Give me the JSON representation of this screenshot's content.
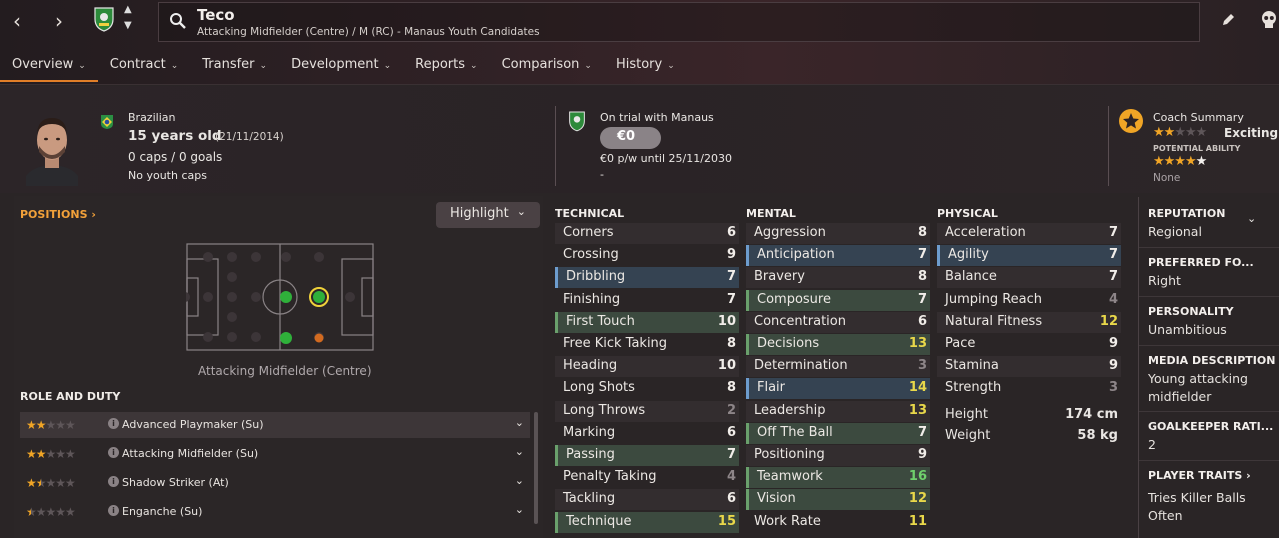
{
  "header": {
    "player_name": "Teco",
    "subtitle": "Attacking Midfielder (Centre) / M (RC) - Manaus Youth Candidates"
  },
  "tabs": [
    {
      "label": "Overview",
      "active": true
    },
    {
      "label": "Contract"
    },
    {
      "label": "Transfer"
    },
    {
      "label": "Development"
    },
    {
      "label": "Reports"
    },
    {
      "label": "Comparison"
    },
    {
      "label": "History"
    }
  ],
  "profile": {
    "nationality": "Brazilian",
    "age": "15 years old",
    "dob": "(21/11/2014)",
    "caps": "0 caps / 0 goals",
    "youth_caps": "No youth caps"
  },
  "club": {
    "status": "On trial with Manaus",
    "value": "€0",
    "wage": "€0 p/w until 25/11/2030",
    "extra": "-"
  },
  "coach": {
    "title": "Coach Summary",
    "current_stars": 2,
    "descriptor": "Exciting y",
    "potential_label": "POTENTIAL ABILITY",
    "potential_stars": 4,
    "footnote": "None"
  },
  "positions": {
    "header": "POSITIONS",
    "highlight_label": "Highlight",
    "main_position": "Attacking Midfielder (Centre)"
  },
  "roles": {
    "header": "ROLE AND DUTY",
    "items": [
      {
        "label": "Advanced Playmaker (Su)",
        "stars": 2
      },
      {
        "label": "Attacking Midfielder (Su)",
        "stars": 2
      },
      {
        "label": "Shadow Striker (At)",
        "stars": 1.5
      },
      {
        "label": "Enganche (Su)",
        "stars": 1
      }
    ]
  },
  "technical": {
    "header": "TECHNICAL",
    "items": [
      {
        "name": "Corners",
        "value": "6"
      },
      {
        "name": "Crossing",
        "value": "9"
      },
      {
        "name": "Dribbling",
        "value": "7",
        "hl": "b"
      },
      {
        "name": "Finishing",
        "value": "7"
      },
      {
        "name": "First Touch",
        "value": "10",
        "hl": "g"
      },
      {
        "name": "Free Kick Taking",
        "value": "8"
      },
      {
        "name": "Heading",
        "value": "10"
      },
      {
        "name": "Long Shots",
        "value": "8"
      },
      {
        "name": "Long Throws",
        "value": "2",
        "tone": "grey"
      },
      {
        "name": "Marking",
        "value": "6"
      },
      {
        "name": "Passing",
        "value": "7",
        "hl": "g"
      },
      {
        "name": "Penalty Taking",
        "value": "4",
        "tone": "grey"
      },
      {
        "name": "Tackling",
        "value": "6"
      },
      {
        "name": "Technique",
        "value": "15",
        "hl": "g",
        "tone": "yellow"
      }
    ]
  },
  "mental": {
    "header": "MENTAL",
    "items": [
      {
        "name": "Aggression",
        "value": "8"
      },
      {
        "name": "Anticipation",
        "value": "7",
        "hl": "b"
      },
      {
        "name": "Bravery",
        "value": "8"
      },
      {
        "name": "Composure",
        "value": "7",
        "hl": "g"
      },
      {
        "name": "Concentration",
        "value": "6"
      },
      {
        "name": "Decisions",
        "value": "13",
        "hl": "g",
        "tone": "yellow"
      },
      {
        "name": "Determination",
        "value": "3",
        "tone": "grey"
      },
      {
        "name": "Flair",
        "value": "14",
        "hl": "b",
        "tone": "yellow"
      },
      {
        "name": "Leadership",
        "value": "13",
        "tone": "yellow"
      },
      {
        "name": "Off The Ball",
        "value": "7",
        "hl": "g"
      },
      {
        "name": "Positioning",
        "value": "9"
      },
      {
        "name": "Teamwork",
        "value": "16",
        "hl": "g",
        "tone": "green"
      },
      {
        "name": "Vision",
        "value": "12",
        "hl": "g",
        "tone": "yellow"
      },
      {
        "name": "Work Rate",
        "value": "11",
        "tone": "yellow"
      }
    ]
  },
  "physical": {
    "header": "PHYSICAL",
    "items": [
      {
        "name": "Acceleration",
        "value": "7"
      },
      {
        "name": "Agility",
        "value": "7",
        "hl": "b"
      },
      {
        "name": "Balance",
        "value": "7"
      },
      {
        "name": "Jumping Reach",
        "value": "4",
        "tone": "grey"
      },
      {
        "name": "Natural Fitness",
        "value": "12",
        "tone": "yellow"
      },
      {
        "name": "Pace",
        "value": "9"
      },
      {
        "name": "Stamina",
        "value": "9"
      },
      {
        "name": "Strength",
        "value": "3",
        "tone": "grey"
      }
    ],
    "height_label": "Height",
    "height_value": "174 cm",
    "weight_label": "Weight",
    "weight_value": "58 kg"
  },
  "side": {
    "reputation_h": "REPUTATION",
    "reputation_v": "Regional",
    "foot_h": "PREFERRED FO...",
    "foot_v": "Right",
    "personality_h": "PERSONALITY",
    "personality_v": "Unambitious",
    "media_h": "MEDIA DESCRIPTION",
    "media_v1": "Young attacking",
    "media_v2": "midfielder",
    "gk_h": "GOALKEEPER RATI...",
    "gk_v": "2",
    "traits_h": "PLAYER TRAITS",
    "traits_v1": "Tries Killer Balls",
    "traits_v2": "Often"
  },
  "colors": {
    "accent": "#e07e28",
    "positions_header": "#f2a13a",
    "star": "#f0a526",
    "good_attr": "#e9d84a",
    "great_attr": "#6fd06c"
  }
}
